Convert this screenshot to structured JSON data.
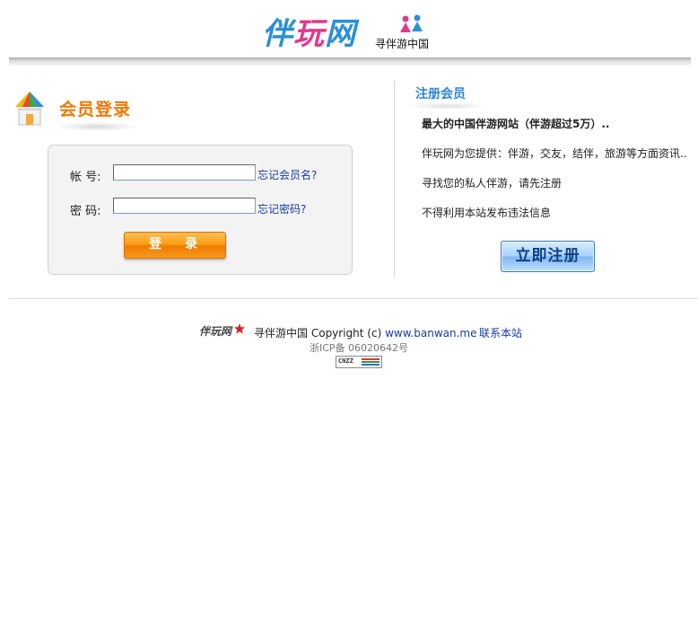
{
  "header": {
    "logo_part1": "伴",
    "logo_part2": "玩",
    "logo_part3": "网",
    "slogan": "寻伴游中国"
  },
  "login": {
    "title": "会员登录",
    "account_label": "帐  号:",
    "password_label": "密  码:",
    "account_value": "",
    "password_value": "",
    "forgot_username": "忘记会员名?",
    "forgot_password": "忘记密码?",
    "submit_label": "登录"
  },
  "register": {
    "title": "注册会员",
    "headline": "最大的中国伴游网站（伴游超过5万）..",
    "line1": "伴玩网为您提供：伴游，交友，结伴，旅游等方面资讯..",
    "line2": "寻找您的私人伴游，请先注册",
    "line3": "不得利用本站发布违法信息",
    "button_label": "立即注册"
  },
  "footer": {
    "logo_text": "伴玩网",
    "slogan": "寻伴游中国",
    "copyright": "Copyright (c)",
    "site_url": "www.banwan.me",
    "contact": "联系本站",
    "icp": "浙ICP备 06020642号",
    "badge": "CNZZ"
  },
  "colors": {
    "accent_orange": "#f07800",
    "accent_blue": "#2e85d6",
    "link_blue": "#1a3c9a",
    "logo_pink": "#e0398b"
  }
}
